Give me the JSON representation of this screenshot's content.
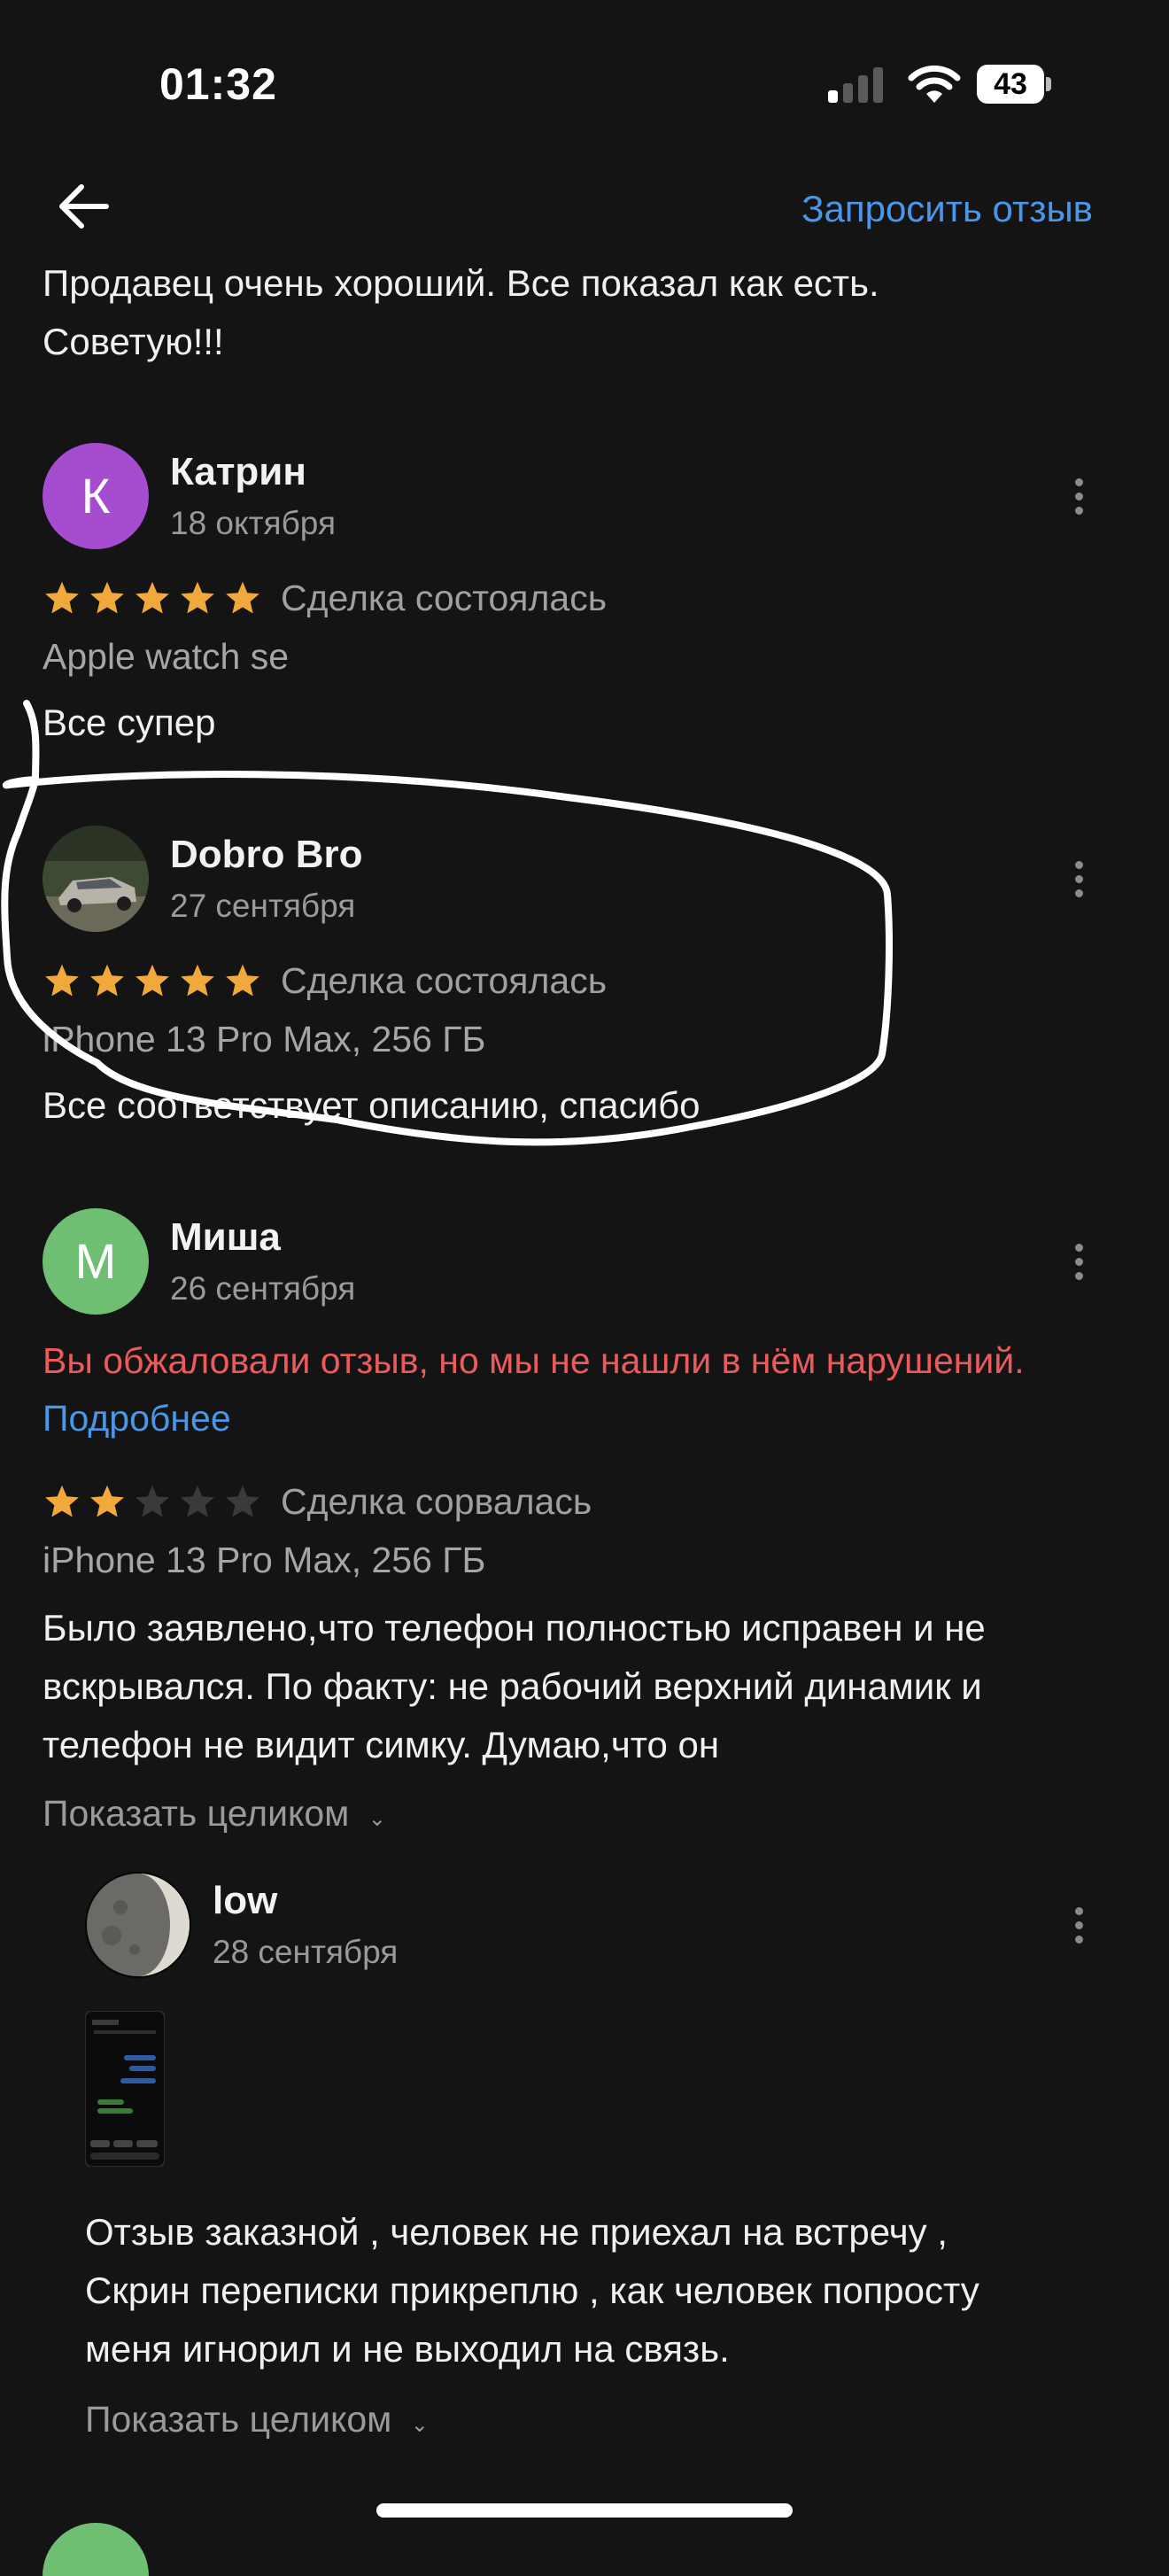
{
  "status_bar": {
    "time": "01:32",
    "battery": "43"
  },
  "header": {
    "request_label": "Запросить отзыв"
  },
  "top_snippet": {
    "line1": "Продавец очень хороший. Все показал как есть.",
    "line2": "Советую!!!"
  },
  "reviews": [
    {
      "initial": "К",
      "avatar_color": "#a54ccf",
      "name": "Катрин",
      "date": "18 октября",
      "rating": 5,
      "status": "Сделка состоялась",
      "item": "Apple watch se",
      "text": "Все супер"
    },
    {
      "name": "Dobro Bro",
      "date": "27 сентября",
      "rating": 5,
      "status": "Сделка состоялась",
      "item": "iPhone 13 Pro Max, 256 ГБ",
      "text": "Все соответствует описанию, спасибо"
    },
    {
      "initial": "М",
      "avatar_color": "#6fbf73",
      "name": "Миша",
      "date": "26 сентября",
      "appeal_notice": "Вы обжаловали отзыв, но мы не нашли в нём нарушений.",
      "more_link": "Подробнее",
      "rating": 2,
      "status": "Сделка сорвалась",
      "item": "iPhone 13 Pro Max, 256 ГБ",
      "text_lines": [
        "Было заявлено,что телефон полностью исправен и не",
        "вскрывался. По факту: не рабочий верхний динамик и",
        "телефон не видит симку. Думаю,что он"
      ],
      "show_full": "Показать целиком"
    }
  ],
  "reply": {
    "name": "low",
    "date": "28 сентября",
    "text_lines": [
      "Отзыв заказной , человек не приехал на встречу ,",
      "Скрин переписки прикреплю , как человек попросту",
      "меня игнорил и не выходил на связь."
    ],
    "show_full": "Показать целиком"
  },
  "colors": {
    "background": "#141414",
    "accent": "#4a96e8",
    "star": "#f2a93b",
    "warning": "#ec5b5b"
  }
}
